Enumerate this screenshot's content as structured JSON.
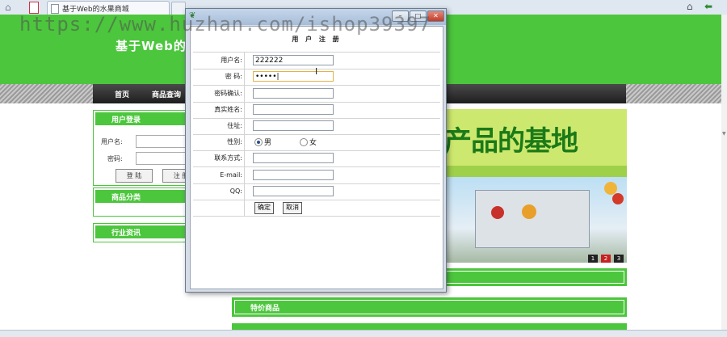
{
  "browser": {
    "tab_title": "基于Web的水果商城"
  },
  "watermark": "https://www.huzhan.com/ishop39397",
  "site": {
    "title": "基于Web的水",
    "nav": [
      "首页",
      "商品查询"
    ],
    "login_box": {
      "title": "用户登录",
      "username_label": "用户名:",
      "password_label": "密码:",
      "login_button": "登 陆",
      "register_button": "注 册"
    },
    "category_box": {
      "title": "商品分类"
    },
    "news_box": {
      "title": "行业资讯"
    },
    "banner_text": "产品的基地",
    "slide_numbers": [
      "1",
      "2",
      "3"
    ],
    "sections": [
      "特价商品"
    ]
  },
  "dialog": {
    "title": "用 户 注 册",
    "fields": {
      "username": {
        "label": "用户名:",
        "value": "222222"
      },
      "password": {
        "label": "密  码:",
        "value": "•••••|"
      },
      "confirm": {
        "label": "密码确认:",
        "value": ""
      },
      "realname": {
        "label": "真实姓名:",
        "value": ""
      },
      "address": {
        "label": "住址:",
        "value": ""
      },
      "gender": {
        "label": "性别:",
        "options": [
          "男",
          "女"
        ],
        "selected": "男"
      },
      "contact": {
        "label": "联系方式:",
        "value": ""
      },
      "email": {
        "label": "E-mail:",
        "value": ""
      },
      "qq": {
        "label": "QQ:",
        "value": ""
      }
    },
    "confirm_button": "确定",
    "cancel_button": "取消"
  }
}
